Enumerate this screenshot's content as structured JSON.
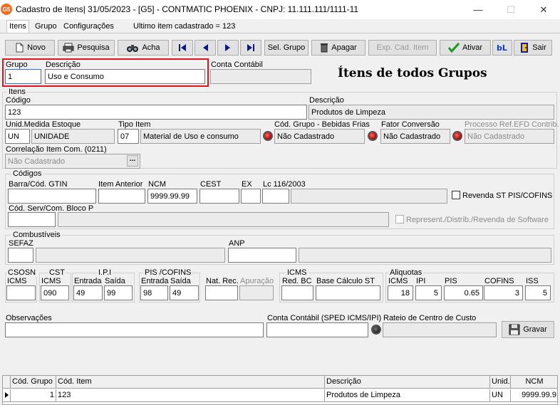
{
  "window": {
    "app_icon_text": "G5",
    "title": "Cadastro de Itens|  31/05/2023 - [G5] - CONTMATIC PHOENIX - CNPJ: 11.111.111/1111-11",
    "minimize": "—",
    "maximize": "☐",
    "close": "✕"
  },
  "menu": {
    "items": [
      "Itens",
      "Grupo",
      "Configurações"
    ],
    "last_item_text": "Ultimo item cadastrado = 123"
  },
  "toolbar": {
    "novo": "Novo",
    "pesquisa": "Pesquisa",
    "acha": "Acha",
    "sel_grupo": "Sel. Grupo",
    "apagar": "Apagar",
    "exp_cad_item": "Exp. Cad. Item",
    "ativar": "Ativar",
    "sair": "Sair",
    "nav_icons": [
      "first-record-icon",
      "previous-record-icon",
      "next-record-icon",
      "last-record-icon"
    ]
  },
  "header": {
    "grupo_label": "Grupo",
    "grupo_value": "1",
    "descricao_label": "Descrição",
    "descricao_value": "Uso e Consumo",
    "conta_contabil_label": "Conta Contábil",
    "conta_contabil_value": "",
    "heading": "Ítens de todos Grupos"
  },
  "itens": {
    "section_title": "Itens",
    "codigo_label": "Código",
    "codigo_value": "123",
    "descricao_label": "Descrição",
    "descricao_value": "Produtos de Limpeza",
    "unid_label": "Unid.Medida Estoque",
    "unid_code": "UN",
    "unid_desc": "UNIDADE",
    "tipo_label": "Tipo Item",
    "tipo_code": "07",
    "tipo_desc": "Material de Uso e consumo",
    "bebidas_label": "Cód. Grupo - Bebidas Frias",
    "bebidas_value": "Não Cadastrado",
    "fator_label": "Fator Conversão",
    "fator_value": "Não Cadastrado",
    "processo_label": "Processo Ref.EFD Contrib.",
    "processo_value": "Não Cadastrado",
    "correlacao_label": "Correlação Item Com. (0211)",
    "correlacao_value": "Não Cadastrado",
    "ellipsis": "..."
  },
  "codigos": {
    "section_title": "Códigos",
    "barra_label": "Barra/Cód. GTIN",
    "barra_value": "",
    "item_anterior_label": "Item Anterior",
    "item_anterior_value": "",
    "ncm_label": "NCM",
    "ncm_value": "9999.99.99",
    "cest_label": "CEST",
    "cest_value": "",
    "ex_label": "EX",
    "ex_value": "",
    "lc_label": "Lc 116/2003",
    "lc_value": "",
    "revenda_label": "Revenda ST PIS/COFINS",
    "serv_label": "Cód. Serv/Com. Bloco P",
    "serv_value": "",
    "represent_label": "Represent./Distrib./Revenda de Software"
  },
  "combustiveis": {
    "section_title": "Combustíveis",
    "sefaz_label": "SEFAZ",
    "sefaz_value": "",
    "anp_label": "ANP",
    "anp_value": ""
  },
  "fiscal": {
    "csosn_label": "CSOSN",
    "csosn_icms_label": "ICMS",
    "csosn_value": "",
    "cst_label": "CST",
    "cst_icms_label": "ICMS",
    "cst_icms_value": "090",
    "ipi_label": "I.P.I",
    "ipi_entrada_label": "Entrada",
    "ipi_entrada_value": "49",
    "ipi_saida_label": "Saída",
    "ipi_saida_value": "99",
    "pis_label": "PIS /COFINS",
    "pis_entrada_label": "Entrada",
    "pis_entrada_value": "98",
    "pis_saida_label": "Saída",
    "pis_saida_value": "49",
    "nat_rec_label": "Nat. Rec.",
    "nat_rec_value": "",
    "apuracao_label": "Apuração",
    "apuracao_value": "",
    "icms_label": "ICMS",
    "red_bc_label": "Red. BC",
    "red_bc_value": "",
    "base_st_label": "Base Cálculo ST",
    "base_st_value": "",
    "aliquotas_label": "Aliquotas",
    "aliq_icms_label": "ICMS",
    "aliq_icms_value": "18",
    "aliq_ipi_label": "IPI",
    "aliq_ipi_value": "5",
    "aliq_pis_label": "PIS",
    "aliq_pis_value": "0.65",
    "aliq_cofins_label": "COFINS",
    "aliq_cofins_value": "3",
    "aliq_iss_label": "ISS",
    "aliq_iss_value": "5"
  },
  "footer": {
    "observacoes_label": "Observações",
    "observacoes_value": "",
    "conta_sped_label": "Conta Contábil (SPED ICMS/IPI)",
    "conta_sped_value": "",
    "rateio_label": "Rateio de Centro de Custo",
    "rateio_value": "",
    "gravar": "Gravar"
  },
  "grid": {
    "columns": [
      "Cód. Grupo",
      "Cód. Item",
      "Descrição",
      "Unid.",
      "NCM"
    ],
    "rows": [
      {
        "cod_grupo": "1",
        "cod_item": "123",
        "descricao": "Produtos de Limpeza",
        "unid": "UN",
        "ncm": "9999.99.9"
      }
    ]
  }
}
